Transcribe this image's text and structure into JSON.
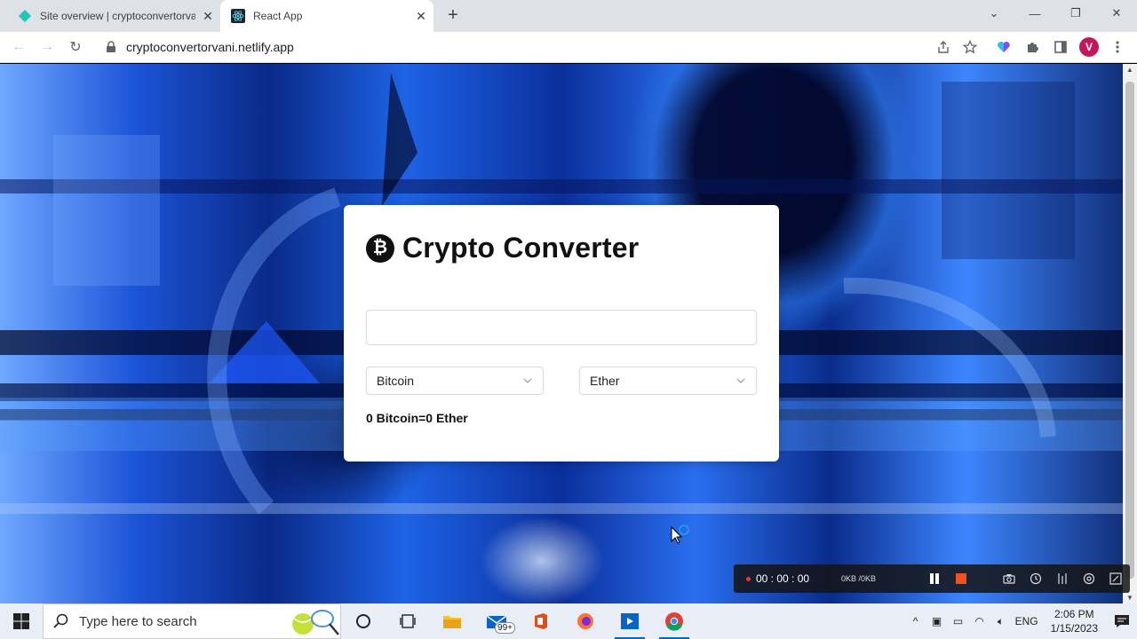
{
  "browser": {
    "tabs": [
      {
        "title": "Site overview | cryptoconvertorvani",
        "active": false
      },
      {
        "title": "React App",
        "active": true
      }
    ],
    "url": "cryptoconvertorvani.netlify.app",
    "profile_initial": "V"
  },
  "app": {
    "logo_symbol": "₿",
    "title": "Crypto Converter",
    "amount_value": "",
    "from_currency": "Bitcoin",
    "to_currency": "Ether",
    "result_text": "0 Bitcoin=0 Ether"
  },
  "recorder": {
    "time": "00 : 00 : 00",
    "size": "0KB /0KB"
  },
  "taskbar": {
    "search_placeholder": "Type here to search",
    "mail_badge": "99+",
    "language": "ENG",
    "time": "2:06 PM",
    "date": "1/15/2023"
  },
  "colors": {
    "accent_profile": "#c2185b",
    "recorder_stop": "#f4511e"
  }
}
